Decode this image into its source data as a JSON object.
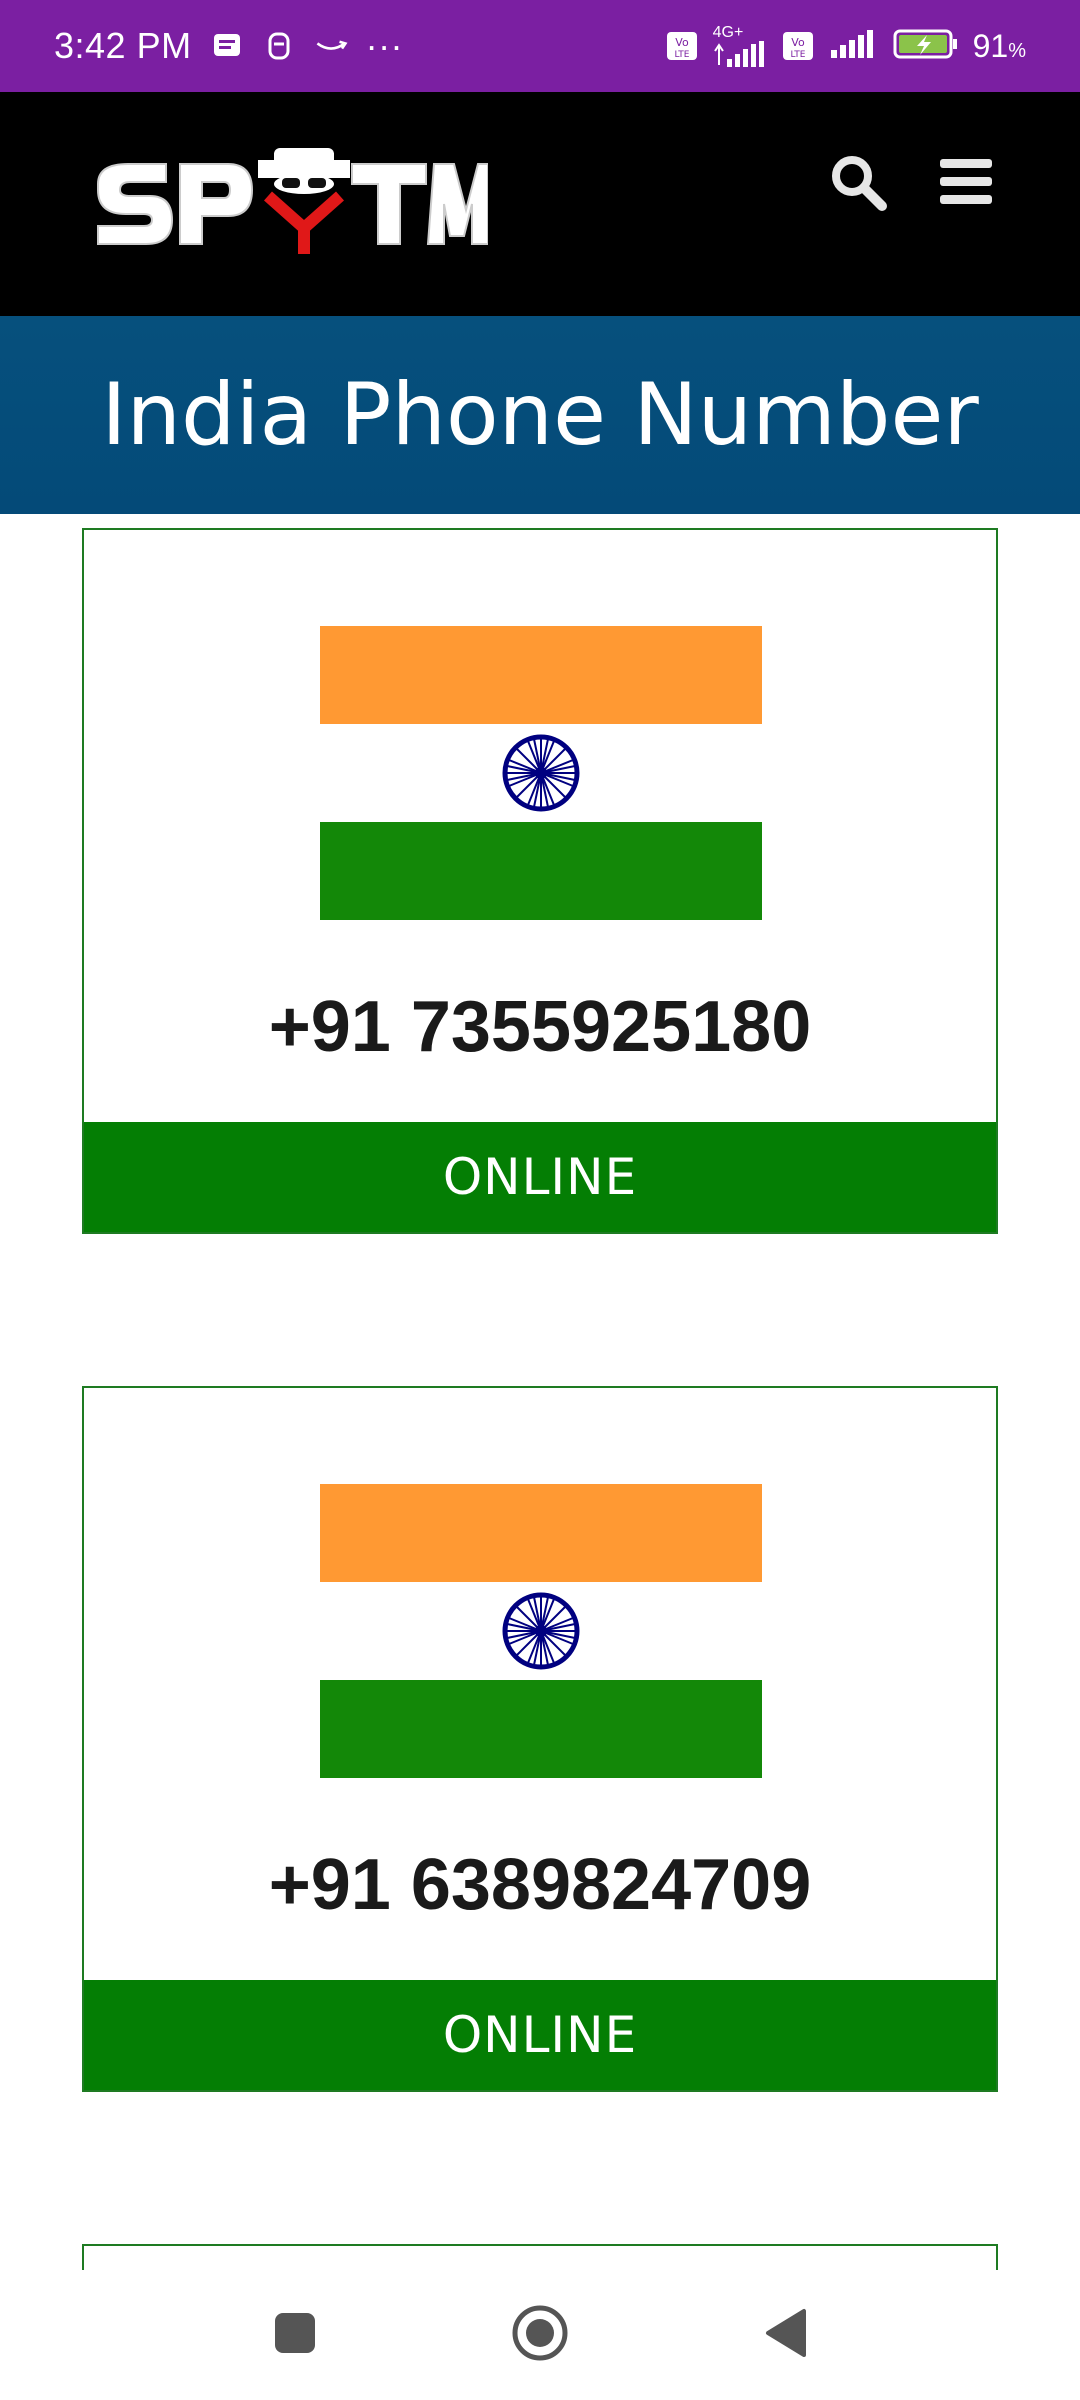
{
  "status_bar": {
    "time": "3:42 PM",
    "left_icons": [
      "message-icon",
      "notification-icon",
      "amazon-icon",
      "more-dots-icon"
    ],
    "more_dots": "···",
    "network_badge": "4G+",
    "battery_percent": "91",
    "battery_unit": "%"
  },
  "header": {
    "logo_text": "SPYTM",
    "search_icon": "search-icon",
    "menu_icon": "hamburger-menu-icon"
  },
  "page": {
    "title": "India Phone Number"
  },
  "cards": [
    {
      "phone": "+91 7355925180",
      "status": "ONLINE"
    },
    {
      "phone": "+91 6389824709",
      "status": "ONLINE"
    }
  ],
  "colors": {
    "status_bar": "#7b1fa2",
    "header": "#000000",
    "title_band": "#06507d",
    "online": "#047e04",
    "saffron": "#ff9933",
    "india_green": "#138808",
    "chakra": "#000080"
  },
  "nav_bar": {
    "icons": [
      "recent-apps-icon",
      "home-icon",
      "back-icon"
    ]
  }
}
